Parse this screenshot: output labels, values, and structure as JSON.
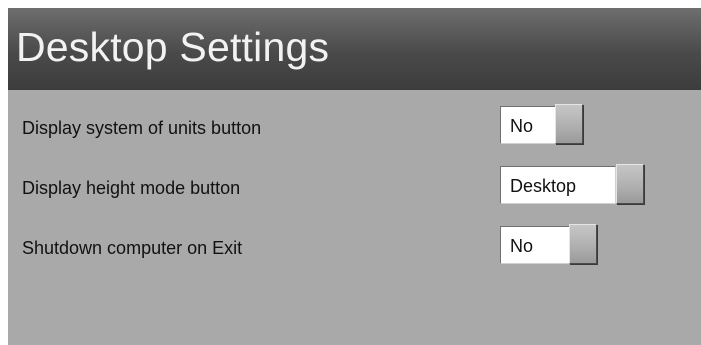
{
  "window": {
    "title": "Desktop Settings"
  },
  "settings": [
    {
      "label": "Display system of units button",
      "value": "No"
    },
    {
      "label": "Display height mode button",
      "value": "Desktop"
    },
    {
      "label": "Shutdown computer on Exit",
      "value": "No"
    }
  ]
}
